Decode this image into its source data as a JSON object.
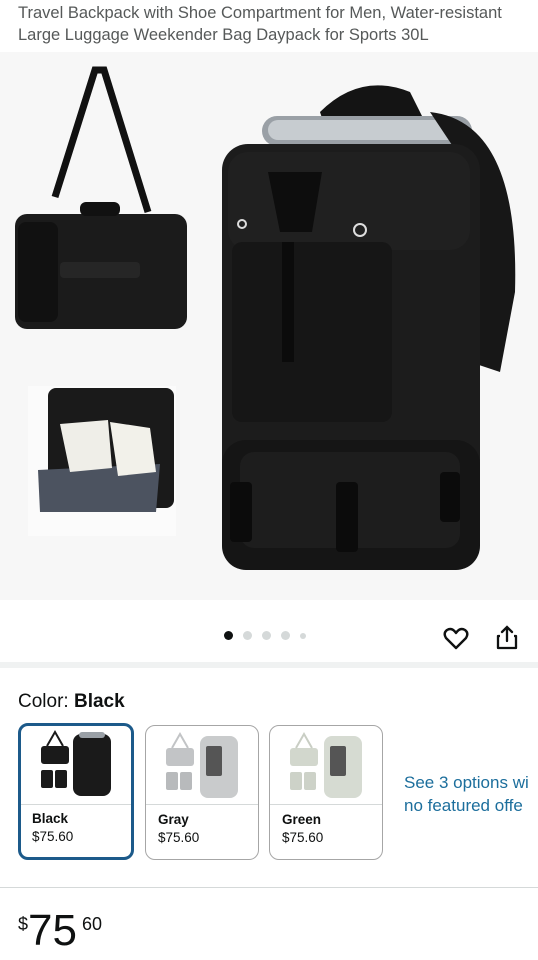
{
  "product": {
    "title": "Travel Backpack with Shoe Compartment for Men, Water-resistant Large Luggage Weekender Bag Daypack for Sports 30L"
  },
  "gallery": {
    "image_count": 5,
    "active_index": 0,
    "icons": [
      "heart-icon",
      "share-icon"
    ]
  },
  "color": {
    "label": "Color: ",
    "selected": "Black",
    "options": [
      {
        "name": "Black",
        "price": "$75.60",
        "swatch_color": "#1a1a1a"
      },
      {
        "name": "Gray",
        "price": "$75.60",
        "swatch_color": "#c9cbcc"
      },
      {
        "name": "Green",
        "price": "$75.60",
        "swatch_color": "#d6dbd2"
      }
    ]
  },
  "see_options": {
    "line1": "See 3 options wi",
    "line2": "no featured offe"
  },
  "price": {
    "currency": "$",
    "whole": "75",
    "fraction": "60"
  },
  "colors": {
    "link": "#1c6e9c",
    "selected_border": "#1c5a8a"
  }
}
